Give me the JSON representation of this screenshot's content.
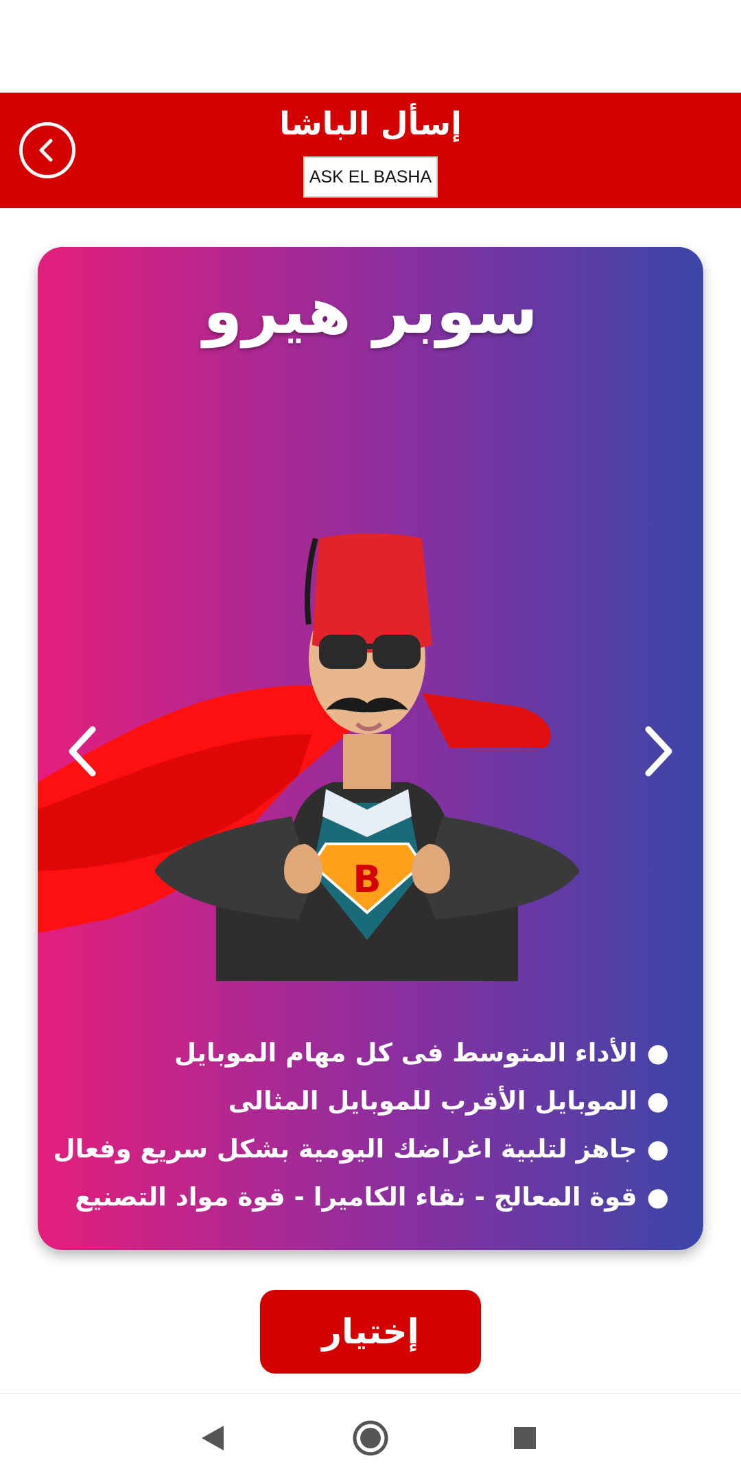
{
  "header": {
    "title": "إسأل الباشا",
    "badge": "ASK EL BASHA"
  },
  "card": {
    "title": "سوبر هيرو",
    "hero_badge_letter": "B",
    "features": [
      "الأداء المتوسط فى كل مهام الموبايل",
      "الموبايل الأقرب للموبايل المثالى",
      "جاهز لتلبية اغراضك اليومية بشكل سريع وفعال",
      "قوة المعالج - نقاء الكاميرا - قوة مواد التصنيع"
    ]
  },
  "actions": {
    "select_label": "إختيار"
  },
  "icons": {
    "back": "back-circle-icon",
    "prev": "chevron-left-icon",
    "next": "chevron-right-icon",
    "sys_back": "triangle-back-icon",
    "sys_home": "circle-home-icon",
    "sys_recents": "square-recents-icon"
  },
  "colors": {
    "brand_red": "#d40000",
    "gradient_start": "#e41e7c",
    "gradient_end": "#3b46a8"
  }
}
